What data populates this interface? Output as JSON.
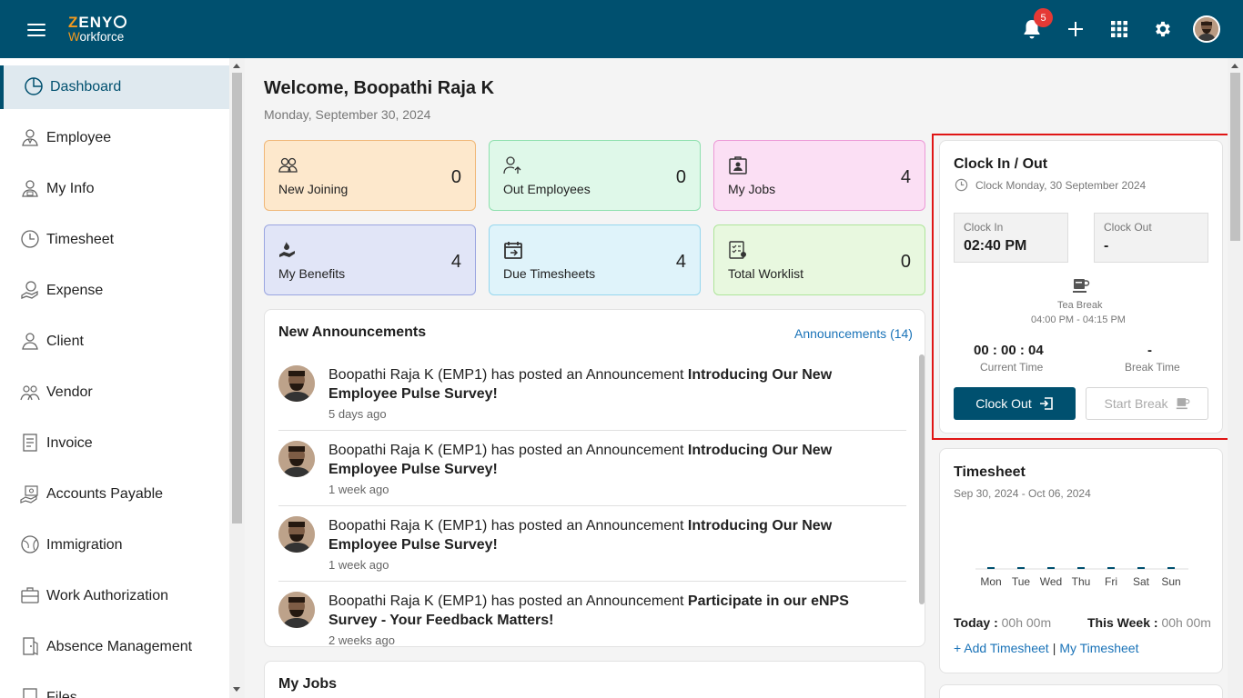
{
  "brand": {
    "line1_accent": "Z",
    "line1_rest": "ENY",
    "line2_accent": "W",
    "line2_rest": "orkforce"
  },
  "header": {
    "notifications_count": "5"
  },
  "sidebar": {
    "items": [
      {
        "label": "Dashboard",
        "icon": "pie-chart-icon",
        "active": true
      },
      {
        "label": "Employee",
        "icon": "employee-icon"
      },
      {
        "label": "My Info",
        "icon": "person-info-icon"
      },
      {
        "label": "Timesheet",
        "icon": "clock-icon"
      },
      {
        "label": "Expense",
        "icon": "expense-icon"
      },
      {
        "label": "Client",
        "icon": "client-icon"
      },
      {
        "label": "Vendor",
        "icon": "vendor-icon"
      },
      {
        "label": "Invoice",
        "icon": "invoice-icon"
      },
      {
        "label": "Accounts Payable",
        "icon": "accounts-payable-icon"
      },
      {
        "label": "Immigration",
        "icon": "globe-icon"
      },
      {
        "label": "Work Authorization",
        "icon": "briefcase-icon"
      },
      {
        "label": "Absence Management",
        "icon": "door-icon"
      },
      {
        "label": "Files",
        "icon": "files-icon"
      }
    ]
  },
  "main": {
    "welcome": "Welcome, Boopathi Raja K",
    "date": "Monday, September 30, 2024",
    "stats": [
      {
        "label": "New Joining",
        "value": "0",
        "bg": "#fde8cc",
        "border": "#f0b777"
      },
      {
        "label": "Out Employees",
        "value": "0",
        "bg": "#dff8e9",
        "border": "#8ee0ae"
      },
      {
        "label": "My Jobs",
        "value": "4",
        "bg": "#fbdff4",
        "border": "#ec99d6"
      },
      {
        "label": "My Benefits",
        "value": "4",
        "bg": "#e1e5f7",
        "border": "#9aa5e0"
      },
      {
        "label": "Due Timesheets",
        "value": "4",
        "bg": "#dff3fa",
        "border": "#96d7ee"
      },
      {
        "label": "Total Worklist",
        "value": "0",
        "bg": "#e8f8df",
        "border": "#aee59a"
      }
    ],
    "announcements": {
      "title": "New Announcements",
      "link": "Announcements (14)",
      "items": [
        {
          "prefix": "Boopathi Raja K (EMP1) has posted an Announcement ",
          "bold": "Introducing Our New Employee Pulse Survey!",
          "time": "5 days ago"
        },
        {
          "prefix": "Boopathi Raja K (EMP1) has posted an Announcement ",
          "bold": "Introducing Our New Employee Pulse Survey!",
          "time": "1 week ago"
        },
        {
          "prefix": "Boopathi Raja K (EMP1) has posted an Announcement ",
          "bold": "Introducing Our New Employee Pulse Survey!",
          "time": "1 week ago"
        },
        {
          "prefix": "Boopathi Raja K (EMP1) has posted an Announcement ",
          "bold": "Participate in our eNPS Survey - Your Feedback Matters!",
          "time": "2 weeks ago"
        }
      ]
    },
    "my_jobs_title": "My Jobs"
  },
  "clock": {
    "title": "Clock In / Out",
    "subtitle": "Clock Monday, 30 September 2024",
    "clock_in_label": "Clock In",
    "clock_in_value": "02:40 PM",
    "clock_out_label": "Clock Out",
    "clock_out_value": "-",
    "break_label": "Tea Break",
    "break_time": "04:00 PM - 04:15 PM",
    "current_time": "00 : 00 : 04",
    "current_time_label": "Current Time",
    "break_time_value": "-",
    "break_time_label": "Break Time",
    "clock_out_button": "Clock Out",
    "start_break_button": "Start Break"
  },
  "timesheet": {
    "title": "Timesheet",
    "range": "Sep 30, 2024 - Oct 06, 2024",
    "today_label": "Today :",
    "today_value": "00h 00m",
    "week_label": "This Week :",
    "week_value": "00h 00m",
    "add_link": "+ Add Timesheet",
    "my_link": "My Timesheet",
    "separator": "|"
  },
  "chart_data": {
    "type": "bar",
    "categories": [
      "Mon",
      "Tue",
      "Wed",
      "Thu",
      "Fri",
      "Sat",
      "Sun"
    ],
    "values": [
      0,
      0,
      0,
      0,
      0,
      0,
      0
    ],
    "color": "#00506f"
  }
}
